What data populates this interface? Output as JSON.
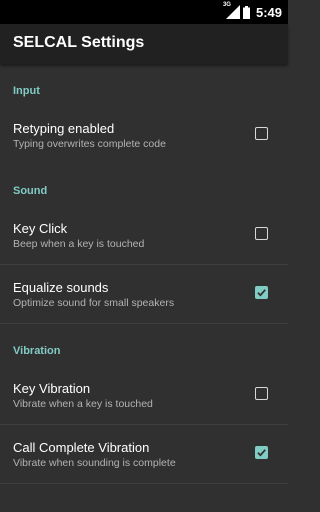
{
  "status_bar": {
    "network_type": "3G",
    "time": "5:49",
    "icons": [
      "signal-icon",
      "battery-icon"
    ]
  },
  "app_bar": {
    "title": "SELCAL Settings"
  },
  "accent_color": "#80cbc4",
  "sections": [
    {
      "header": "Input",
      "items": [
        {
          "title": "Retyping enabled",
          "summary": "Typing overwrites complete code",
          "checked": false
        }
      ]
    },
    {
      "header": "Sound",
      "items": [
        {
          "title": "Key Click",
          "summary": "Beep when a key is touched",
          "checked": false
        },
        {
          "title": "Equalize sounds",
          "summary": "Optimize sound for small speakers",
          "checked": true
        }
      ]
    },
    {
      "header": "Vibration",
      "items": [
        {
          "title": "Key Vibration",
          "summary": "Vibrate when a key is touched",
          "checked": false
        },
        {
          "title": "Call Complete Vibration",
          "summary": "Vibrate when sounding is complete",
          "checked": true
        }
      ]
    }
  ]
}
